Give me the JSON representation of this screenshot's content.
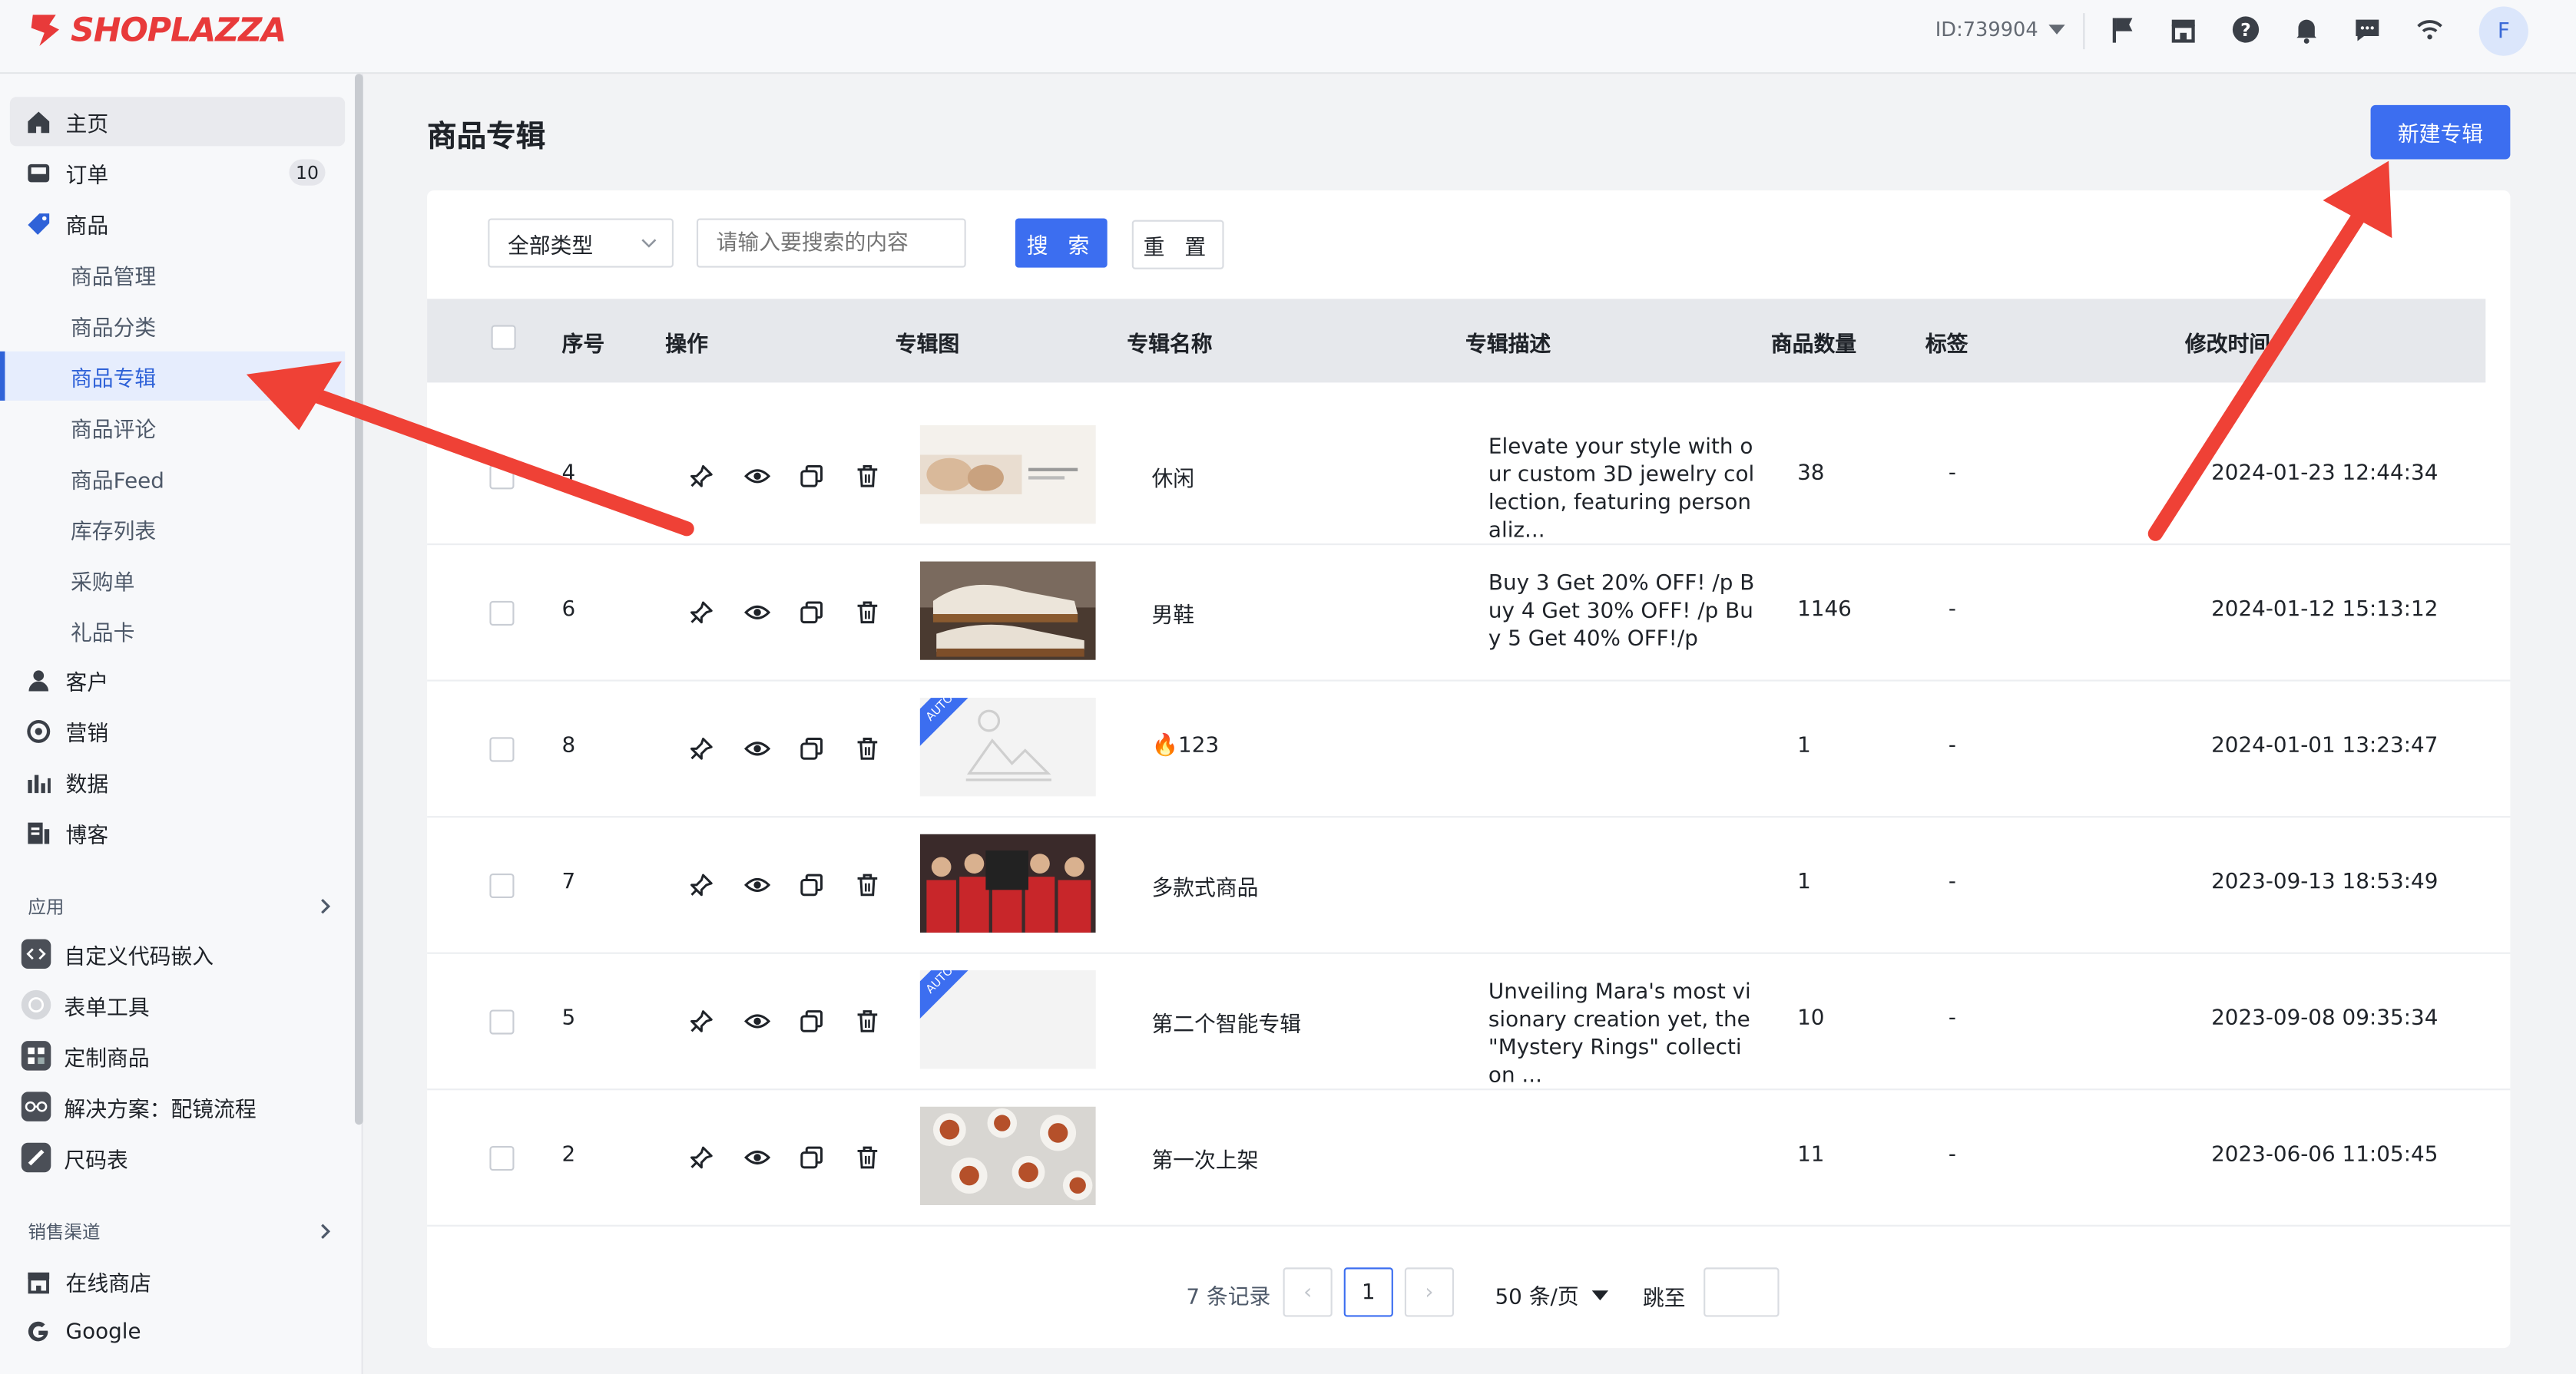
{
  "header": {
    "logo_text": "SHOPLAZZA",
    "store_id": "ID:739904",
    "avatar_letter": "F",
    "icons": [
      "flag-icon",
      "store-icon",
      "help-icon",
      "bell-icon",
      "message-icon",
      "wifi-icon"
    ]
  },
  "sidebar": {
    "items": [
      {
        "label": "主页",
        "icon": "home-icon"
      },
      {
        "label": "订单",
        "icon": "inbox-icon",
        "badge": "10"
      },
      {
        "label": "商品",
        "icon": "tag-icon"
      },
      {
        "label": "客户",
        "icon": "user-icon"
      },
      {
        "label": "营销",
        "icon": "target-icon"
      },
      {
        "label": "数据",
        "icon": "bar-chart-icon"
      },
      {
        "label": "博客",
        "icon": "blog-icon"
      }
    ],
    "product_sub": [
      "商品管理",
      "商品分类",
      "商品专辑",
      "商品评论",
      "商品Feed",
      "库存列表",
      "采购单",
      "礼品卡"
    ],
    "apps_title": "应用",
    "apps": [
      "自定义代码嵌入",
      "表单工具",
      "定制商品",
      "解决方案：配镜流程",
      "尺码表"
    ],
    "channels_title": "销售渠道",
    "channels": [
      "在线商店",
      "Google"
    ]
  },
  "main": {
    "title": "商品专辑",
    "new_button": "新建专辑",
    "filter": {
      "type_value": "全部类型",
      "search_placeholder": "请输入要搜索的内容",
      "search_button": "搜 索",
      "reset_button": "重 置"
    },
    "columns": [
      "序号",
      "操作",
      "专辑图",
      "专辑名称",
      "专辑描述",
      "商品数量",
      "标签",
      "修改时间"
    ],
    "rows": [
      {
        "seq": "4",
        "name": "休闲",
        "desc": "Elevate your style with our custom 3D jewelry collection, featuring personaliz...",
        "count": "38",
        "tag": "-",
        "time": "2024-01-23 12:44:34",
        "thumb": "jewelry",
        "auto": false
      },
      {
        "seq": "6",
        "name": "男鞋",
        "desc": "Buy 3 Get 20% OFF! /p Buy 4 Get 30% OFF! /p Buy 5 Get 40% OFF!/p",
        "count": "1146",
        "tag": "-",
        "time": "2024-01-12 15:13:12",
        "thumb": "shoe",
        "auto": false
      },
      {
        "seq": "8",
        "name": "🔥123",
        "desc": "",
        "count": "1",
        "tag": "-",
        "time": "2024-01-01 13:23:47",
        "thumb": "placeholder",
        "auto": true
      },
      {
        "seq": "7",
        "name": "多款式商品",
        "desc": "",
        "count": "1",
        "tag": "-",
        "time": "2023-09-13 18:53:49",
        "thumb": "team",
        "auto": false
      },
      {
        "seq": "5",
        "name": "第二个智能专辑",
        "desc": "Unveiling Mara's most visionary creation yet, the \"Mystery Rings\" collection ...",
        "count": "10",
        "tag": "-",
        "time": "2023-09-08 09:35:34",
        "thumb": "blank",
        "auto": true
      },
      {
        "seq": "2",
        "name": "第一次上架",
        "desc": "",
        "count": "11",
        "tag": "-",
        "time": "2023-06-06 11:05:45",
        "thumb": "tea",
        "auto": false
      }
    ],
    "auto_label": "AUTO",
    "pagination": {
      "total": "7 条记录",
      "current_page": "1",
      "page_size": "50 条/页",
      "jump_label": "跳至"
    }
  },
  "colors": {
    "primary": "#3c6ef0",
    "brand": "#e83a3a",
    "annotation_arrow": "#ef4136"
  }
}
